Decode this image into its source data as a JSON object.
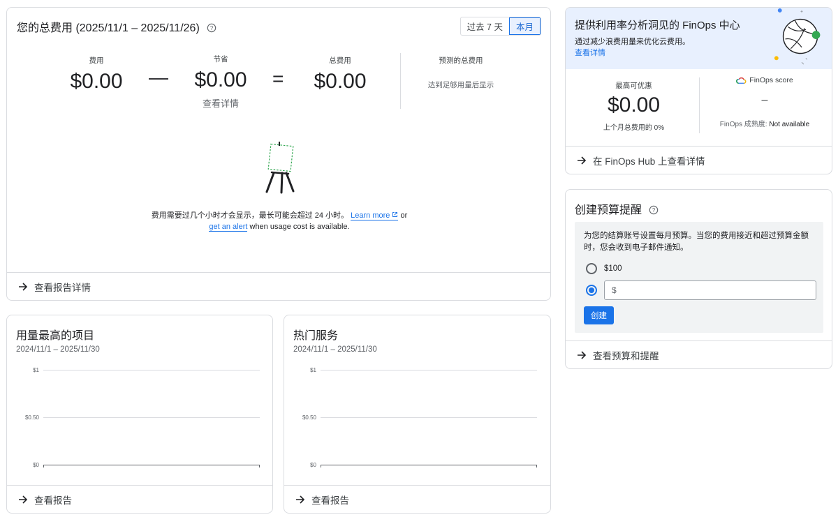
{
  "cost_card": {
    "title": "您的总费用 (2025/11/1 – 2025/11/26)",
    "toggle": [
      "过去 7 天",
      "本月"
    ],
    "active_toggle": "本月",
    "cost_label": "费用",
    "cost_value": "$0.00",
    "minus": "—",
    "savings_label": "节省",
    "savings_value": "$0.00",
    "savings_link": "查看详情",
    "equals": "=",
    "total_label": "总费用",
    "total_value": "$0.00",
    "forecast_label": "预测的总费用",
    "forecast_note": "达到足够用量后显示",
    "message_part1": "费用需要过几个小时才会显示，最长可能会超过 24 小时。",
    "learn_more": "Learn more",
    "or": "or",
    "get_alert": "get an alert",
    "message_part2": "when usage cost is available.",
    "footer": "查看报告详情"
  },
  "top_projects": {
    "title": "用量最高的项目",
    "range": "2024/11/1 – 2025/11/30",
    "y_ticks": [
      "$1",
      "$0.50",
      "$0"
    ],
    "footer": "查看报告"
  },
  "top_services": {
    "title": "热门服务",
    "range": "2024/11/1 – 2025/11/30",
    "y_ticks": [
      "$1",
      "$0.50",
      "$0"
    ],
    "footer": "查看报告"
  },
  "finops": {
    "title": "提供利用率分析洞见的 FinOps 中心",
    "desc": "通过减少浪费用量来优化云费用。",
    "link": "查看详情",
    "max_discount_label": "最高可优惠",
    "max_discount_value": "$0.00",
    "max_discount_note": "上个月总费用的 0%",
    "score_label": "FinOps score",
    "score_value": "–",
    "maturity_label": "FinOps 成熟度:",
    "maturity_value": "Not available",
    "footer": "在 FinOps Hub 上查看详情"
  },
  "budget": {
    "title": "创建预算提醒",
    "desc": "为您的结算账号设置每月预算。当您的费用接近和超过预算金额时，您会收到电子邮件通知。",
    "option_100": "$100",
    "custom_prefix": "$",
    "custom_value": "",
    "create_button": "创建",
    "footer": "查看预算和提醒"
  },
  "colors": {
    "accent": "#1a73e8",
    "finops_banner": "#e8f0fe",
    "illustration_green": "#34a853"
  }
}
